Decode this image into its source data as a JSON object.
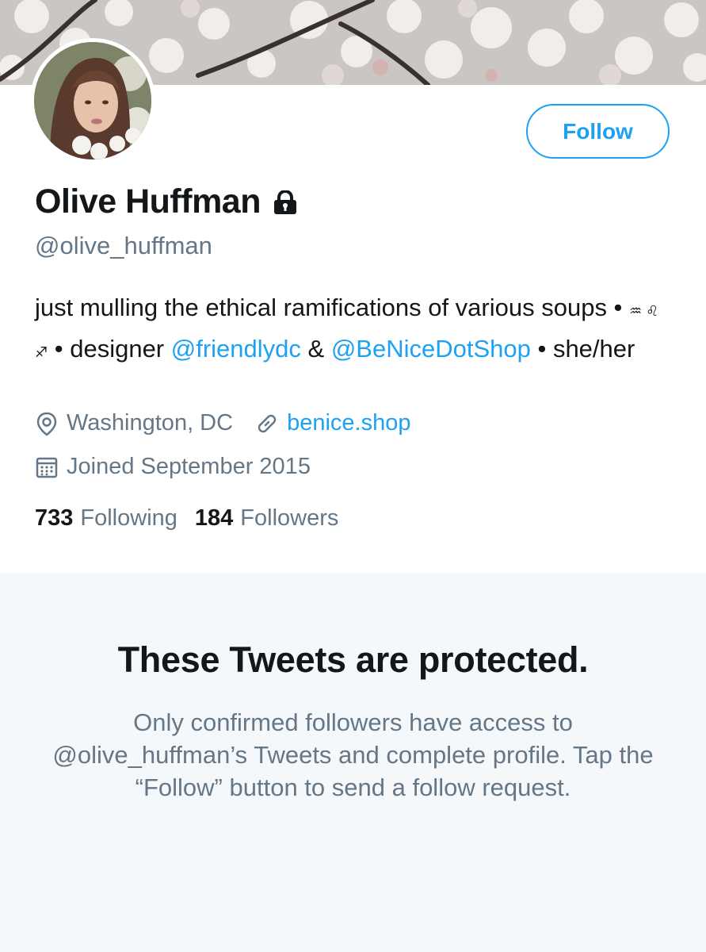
{
  "profile": {
    "name": "Olive Huffman",
    "handle": "@olive_huffman",
    "follow_label": "Follow",
    "bio": {
      "part1": "just mulling the ethical ramifications of various soups • ",
      "zodiac": "♒︎ ♌︎ ♐︎",
      "part2": " • designer ",
      "mention1": "@friendlydc",
      "part3": " & ",
      "mention2": "@BeNiceDotShop",
      "part4": " • she/her"
    },
    "location": "Washington, DC",
    "website": "benice.shop",
    "joined": "Joined September 2015",
    "following_count": "733",
    "following_label": "Following",
    "followers_count": "184",
    "followers_label": "Followers"
  },
  "protected": {
    "title": "These Tweets are protected.",
    "body": "Only confirmed followers have access to @olive_huffman’s Tweets and complete profile. Tap the “Follow” button to send a follow request."
  },
  "icons": {
    "lock": "lock-icon",
    "location": "location-pin-icon",
    "link": "link-icon",
    "calendar": "calendar-icon"
  },
  "colors": {
    "accent": "#1da1f2",
    "secondary_text": "#657786",
    "primary_text": "#14171a",
    "protected_bg": "#f5f8fa"
  }
}
